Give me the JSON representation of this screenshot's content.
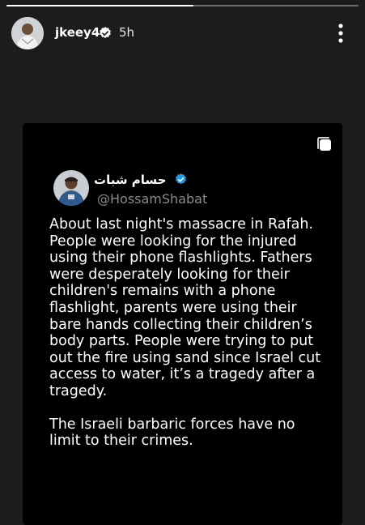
{
  "story": {
    "progress_fraction": 0.53,
    "username": "jkeey4",
    "posted_ago": "5h",
    "icons": {
      "verified": "verified-badge-icon",
      "more": "more-vertical-icon",
      "copy": "copy-icon"
    }
  },
  "tweet": {
    "display_name": "حسام شبات",
    "handle": "@HossamShabat",
    "paragraphs": [
      "About last night's massacre in Rafah. People were looking for the injured using their phone flashlights. Fathers were desperately looking for their children's remains with a phone flashlight, parents were using their bare hands collecting their children’s body parts. People were trying to put out the fire using sand since Israel cut access to water, it’s a tragedy after a tragedy.",
      "The Israeli barbaric forces have no limit to their crimes."
    ]
  },
  "colors": {
    "verified": "#1d9bf0",
    "handle": "#8a8a8a",
    "background": "#1c1c1c",
    "card": "#000000"
  }
}
